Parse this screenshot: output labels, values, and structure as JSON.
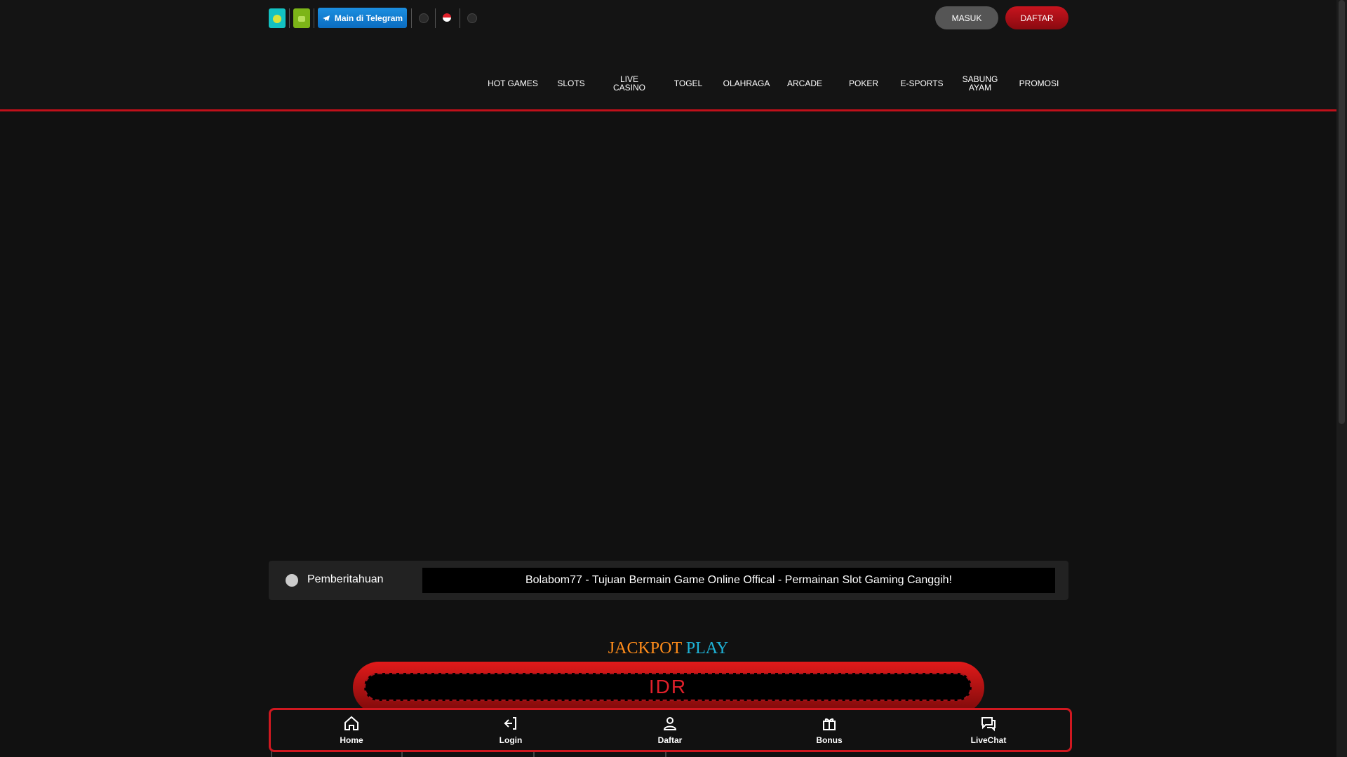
{
  "topbar": {
    "telegram_label": "Main di Telegram",
    "login_label": "MASUK",
    "register_label": "DAFTAR"
  },
  "nav": {
    "items": [
      {
        "label": "HOT GAMES"
      },
      {
        "label": "SLOTS"
      },
      {
        "label": "LIVE CASINO"
      },
      {
        "label": "TOGEL"
      },
      {
        "label": "OLAHRAGA"
      },
      {
        "label": "ARCADE"
      },
      {
        "label": "POKER"
      },
      {
        "label": "E-SPORTS"
      },
      {
        "label": "SABUNG AYAM"
      },
      {
        "label": "PROMOSI"
      }
    ]
  },
  "notice": {
    "label": "Pemberitahuan",
    "message": "Bolabom77 - Tujuan Bermain Game Online Offical - Permainan Slot Gaming Canggih!"
  },
  "jackpot": {
    "title_word1": "JACKPOT",
    "title_word2": "PLAY",
    "currency": "IDR"
  },
  "bottom_nav": {
    "items": [
      {
        "label": "Home",
        "icon": "home-icon"
      },
      {
        "label": "Login",
        "icon": "login-icon"
      },
      {
        "label": "Daftar",
        "icon": "user-icon"
      },
      {
        "label": "Bonus",
        "icon": "gift-icon"
      },
      {
        "label": "LiveChat",
        "icon": "chat-icon"
      }
    ]
  },
  "colors": {
    "background": "#111111",
    "accent_red": "#c0101a",
    "jackpot_orange": "#ff8c1a",
    "jackpot_blue": "#1eb2d6",
    "telegram_blue": "#1c8fe0"
  }
}
